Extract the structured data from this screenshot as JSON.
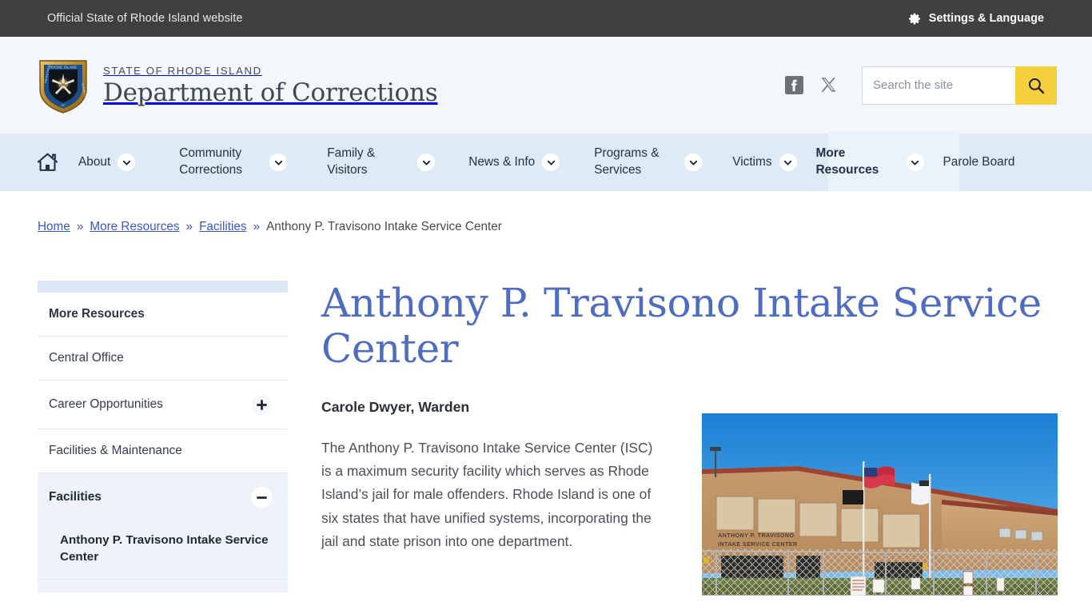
{
  "utility_bar": {
    "official_text": "Official State of Rhode Island website",
    "settings_label": "Settings & Language",
    "gear_icon": "gear-icon",
    "background": "#3f3f3f"
  },
  "masthead": {
    "seal_icon": "ri-doc-seal-icon",
    "eyebrow": "STATE OF RHODE ISLAND",
    "title": "Department of Corrections",
    "social": [
      {
        "name": "facebook-icon",
        "label": "Facebook"
      },
      {
        "name": "x-twitter-icon",
        "label": "X"
      }
    ],
    "search": {
      "placeholder": "Search the site",
      "value": "",
      "button_icon": "search-icon",
      "button_color": "#f5cf3d"
    }
  },
  "nav": {
    "home_icon": "home-icon",
    "background": "#dfeaf7",
    "items": [
      {
        "label": "About",
        "has_dropdown": true,
        "active": false
      },
      {
        "label": "Community Corrections",
        "has_dropdown": true,
        "active": false
      },
      {
        "label": "Family & Visitors",
        "has_dropdown": true,
        "active": false
      },
      {
        "label": "News & Info",
        "has_dropdown": true,
        "active": false
      },
      {
        "label": "Programs & Services",
        "has_dropdown": true,
        "active": false
      },
      {
        "label": "Victims",
        "has_dropdown": true,
        "active": false
      },
      {
        "label": "More Resources",
        "has_dropdown": true,
        "active": true
      },
      {
        "label": "Parole Board",
        "has_dropdown": false,
        "active": false
      }
    ]
  },
  "breadcrumb": {
    "separator": "»",
    "items": [
      {
        "label": "Home",
        "link": true
      },
      {
        "label": "More Resources",
        "link": true
      },
      {
        "label": "Facilities",
        "link": true
      },
      {
        "label": "Anthony P. Travisono Intake Service Center",
        "link": false
      }
    ]
  },
  "sidebar": {
    "items": [
      {
        "label": "More Resources",
        "type": "heading",
        "toggle": null
      },
      {
        "label": "Central Office",
        "type": "link",
        "toggle": null
      },
      {
        "label": "Career Opportunities",
        "type": "link",
        "toggle": "plus"
      },
      {
        "label": "Facilities & Maintenance",
        "type": "link",
        "toggle": null
      },
      {
        "label": "Facilities",
        "type": "expanded",
        "toggle": "minus"
      }
    ],
    "sub_items": [
      {
        "label": "Anthony P. Travisono Intake Service Center",
        "current": true
      }
    ]
  },
  "main": {
    "title": "Anthony P. Travisono Intake Service Center",
    "title_color": "#4f6cc0",
    "warden": "Carole Dwyer, Warden",
    "paragraph": "The Anthony P. Travisono Intake Service Center (ISC) is a maximum security facility which serves as Rhode Island’s jail for male offenders. Rhode Island is one of six states that have unified systems, incorporating the jail and state prison into one department.",
    "photo": {
      "name": "facility-photo",
      "alt": "Anthony P. Travisono Intake Service Center building exterior",
      "sign_line1": "ANTHONY P. TRAVISONO",
      "sign_line2": "INTAKE SERVICE CENTER"
    }
  }
}
